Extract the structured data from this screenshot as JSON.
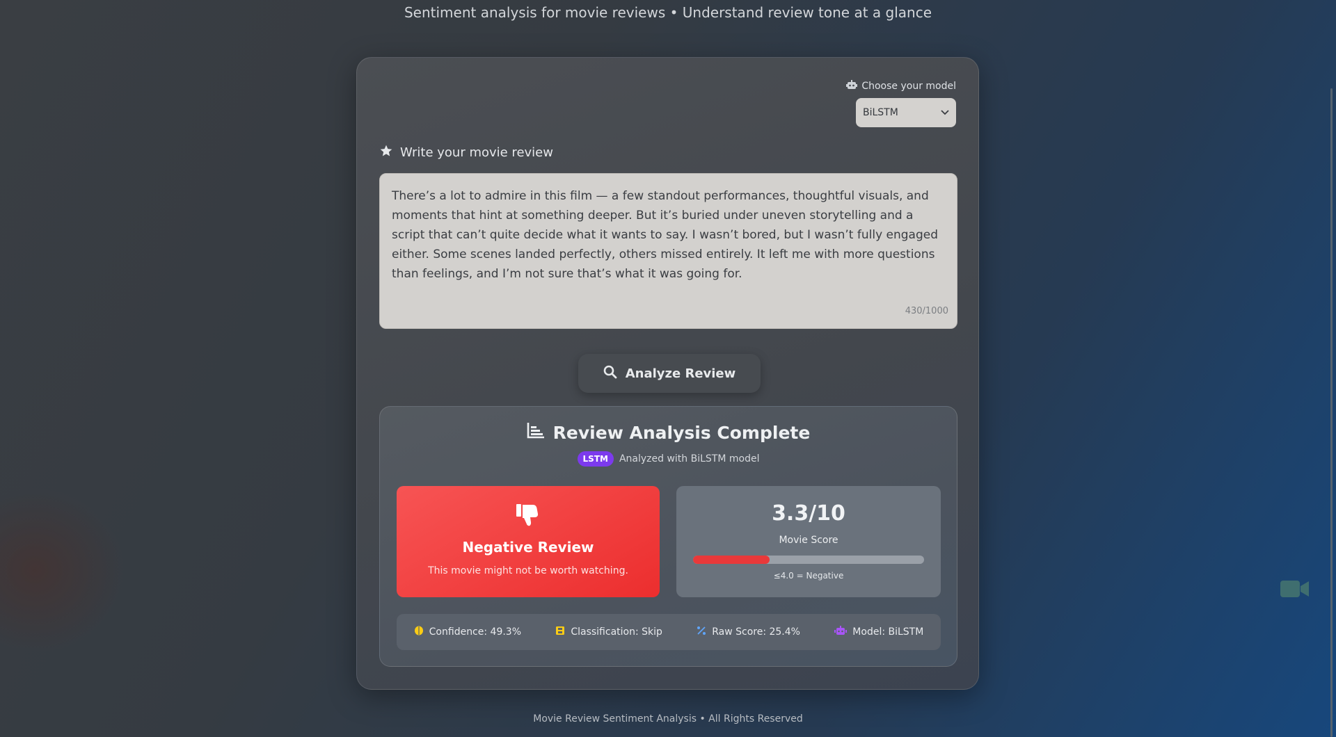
{
  "header": {
    "subtitle": "Sentiment analysis for movie reviews • Understand review tone at a glance"
  },
  "model_picker": {
    "label": "Choose your model",
    "selected": "BiLSTM",
    "icon": "robot-icon"
  },
  "review": {
    "label": "Write your movie review",
    "text": " There’s a lot to admire in this film — a few standout performances, thoughtful visuals, and moments that hint at something deeper. But it’s buried under uneven storytelling and a script that can’t quite decide what it wants to say. I wasn’t bored, but I wasn’t fully engaged either. Some scenes landed perfectly, others missed entirely. It left me with more questions than feelings, and I’m not sure that’s what it was going for.",
    "char_count": "430/1000"
  },
  "actions": {
    "analyze_label": "Analyze Review"
  },
  "results": {
    "title": "Review Analysis Complete",
    "badge": "LSTM",
    "analyzed_with": "Analyzed with BiLSTM model",
    "verdict": {
      "title": "Negative Review",
      "description": "This movie might not be worth watching.",
      "color": "#ef4444"
    },
    "score": {
      "value": "3.3/10",
      "label": "Movie Score",
      "fraction": 0.33,
      "note": "≤4.0 = Negative"
    },
    "stats": {
      "confidence": "Confidence: 49.3%",
      "classification": "Classification: Skip",
      "raw_score": "Raw Score: 25.4%",
      "model": "Model: BiLSTM"
    }
  },
  "footer": {
    "text": "Movie Review Sentiment Analysis • All Rights Reserved"
  },
  "colors": {
    "accent_purple": "#7c3aed",
    "negative_red": "#ef4444",
    "brain_yellow": "#facc15",
    "percent_blue": "#60a5fa",
    "robot_purple": "#a855f7"
  }
}
